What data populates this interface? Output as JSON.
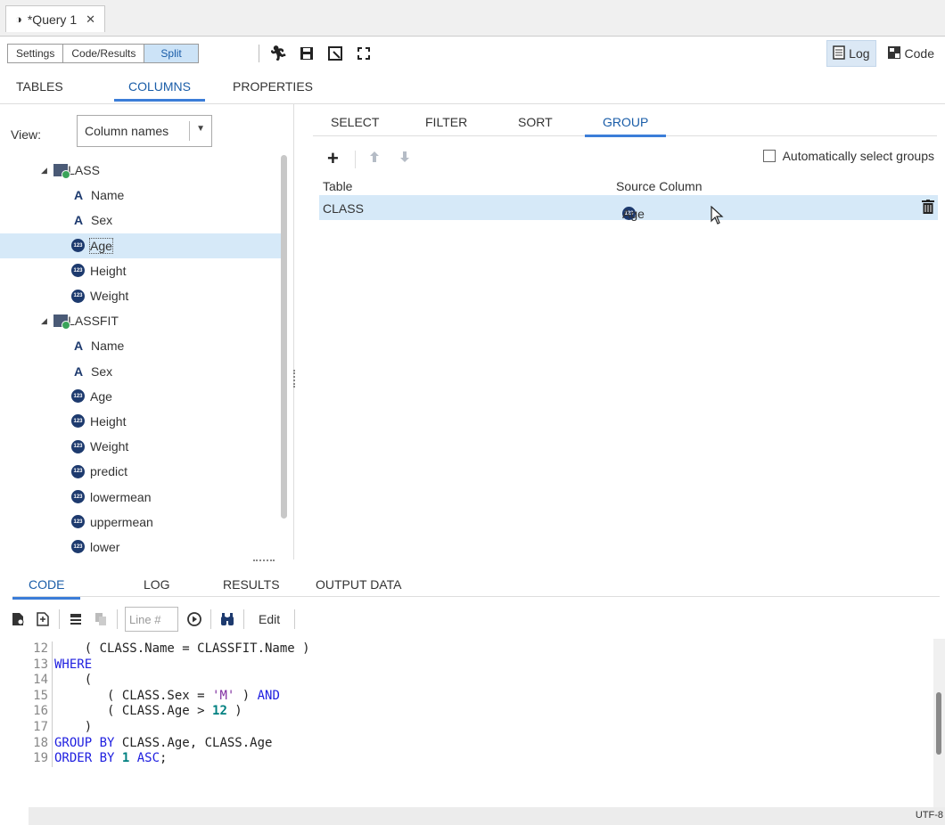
{
  "doc_tab": {
    "title": "*Query 1",
    "close": "✕"
  },
  "toolbar": {
    "settings": "Settings",
    "code_results": "Code/Results",
    "split": "Split",
    "log": "Log",
    "code": "Code"
  },
  "subtabs": [
    "TABLES",
    "COLUMNS",
    "PROPERTIES"
  ],
  "left": {
    "view_label": "View:",
    "view_value": "Column names",
    "tree": [
      {
        "type": "table",
        "label": "CLASS"
      },
      {
        "type": "char",
        "label": "Name"
      },
      {
        "type": "char",
        "label": "Sex"
      },
      {
        "type": "num",
        "label": "Age",
        "selected": true
      },
      {
        "type": "num",
        "label": "Height"
      },
      {
        "type": "num",
        "label": "Weight"
      },
      {
        "type": "table",
        "label": "CLASSFIT"
      },
      {
        "type": "char",
        "label": "Name"
      },
      {
        "type": "char",
        "label": "Sex"
      },
      {
        "type": "num",
        "label": "Age"
      },
      {
        "type": "num",
        "label": "Height"
      },
      {
        "type": "num",
        "label": "Weight"
      },
      {
        "type": "num",
        "label": "predict"
      },
      {
        "type": "num",
        "label": "lowermean"
      },
      {
        "type": "num",
        "label": "uppermean"
      },
      {
        "type": "num",
        "label": "lower"
      }
    ]
  },
  "right": {
    "tabs": [
      "SELECT",
      "FILTER",
      "SORT",
      "GROUP"
    ],
    "auto_groups_label": "Automatically select groups",
    "grid_headers": {
      "table": "Table",
      "source": "Source Column"
    },
    "grid_rows": [
      {
        "table": "CLASS",
        "source": "Age"
      }
    ]
  },
  "bottom": {
    "tabs": [
      "CODE",
      "LOG",
      "RESULTS",
      "OUTPUT DATA"
    ],
    "line_placeholder": "Line #",
    "edit": "Edit",
    "encoding": "UTF-8"
  },
  "code_lines": [
    {
      "n": "12",
      "parts": [
        {
          "t": "tx",
          "s": "    ( CLASS.Name = CLASSFIT.Name )"
        }
      ]
    },
    {
      "n": "13",
      "parts": [
        {
          "t": "kw",
          "s": "WHERE"
        }
      ]
    },
    {
      "n": "14",
      "parts": [
        {
          "t": "tx",
          "s": "    ("
        }
      ]
    },
    {
      "n": "15",
      "parts": [
        {
          "t": "tx",
          "s": "       ( CLASS.Sex = "
        },
        {
          "t": "str",
          "s": "'M'"
        },
        {
          "t": "tx",
          "s": " ) "
        },
        {
          "t": "kw",
          "s": "AND"
        }
      ]
    },
    {
      "n": "16",
      "parts": [
        {
          "t": "tx",
          "s": "       ( CLASS.Age > "
        },
        {
          "t": "num",
          "s": "12"
        },
        {
          "t": "tx",
          "s": " )"
        }
      ]
    },
    {
      "n": "17",
      "parts": [
        {
          "t": "tx",
          "s": "    )"
        }
      ]
    },
    {
      "n": "18",
      "parts": [
        {
          "t": "kw",
          "s": "GROUP BY"
        },
        {
          "t": "tx",
          "s": " CLASS.Age, CLASS.Age"
        }
      ]
    },
    {
      "n": "19",
      "parts": [
        {
          "t": "kw",
          "s": "ORDER BY"
        },
        {
          "t": "tx",
          "s": " "
        },
        {
          "t": "num",
          "s": "1"
        },
        {
          "t": "tx",
          "s": " "
        },
        {
          "t": "kw",
          "s": "ASC"
        },
        {
          "t": "tx",
          "s": ";"
        }
      ]
    }
  ]
}
